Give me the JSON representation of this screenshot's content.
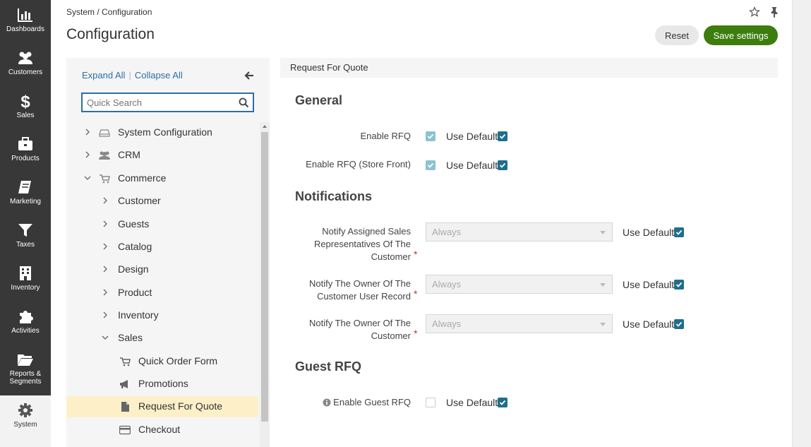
{
  "nav": {
    "items": [
      {
        "label": "Dashboards",
        "icon": "dashboards-icon"
      },
      {
        "label": "Customers",
        "icon": "customers-icon"
      },
      {
        "label": "Sales",
        "icon": "sales-icon"
      },
      {
        "label": "Products",
        "icon": "products-icon"
      },
      {
        "label": "Marketing",
        "icon": "marketing-icon"
      },
      {
        "label": "Taxes",
        "icon": "taxes-icon"
      },
      {
        "label": "Inventory",
        "icon": "inventory-icon"
      },
      {
        "label": "Activities",
        "icon": "activities-icon"
      },
      {
        "label": "Reports & Segments",
        "icon": "reports-icon"
      },
      {
        "label": "System",
        "icon": "gear-icon"
      }
    ]
  },
  "header": {
    "breadcrumb": "System / Configuration",
    "title": "Configuration",
    "reset_label": "Reset",
    "save_label": "Save settings"
  },
  "tree": {
    "expand_all": "Expand All",
    "collapse_all": "Collapse All",
    "search_placeholder": "Quick Search",
    "items": [
      {
        "label": "System Configuration"
      },
      {
        "label": "CRM"
      },
      {
        "label": "Commerce"
      },
      {
        "label": "Customer"
      },
      {
        "label": "Guests"
      },
      {
        "label": "Catalog"
      },
      {
        "label": "Design"
      },
      {
        "label": "Product"
      },
      {
        "label": "Inventory"
      },
      {
        "label": "Sales"
      },
      {
        "label": "Quick Order Form"
      },
      {
        "label": "Promotions"
      },
      {
        "label": "Request For Quote"
      },
      {
        "label": "Checkout"
      }
    ]
  },
  "content": {
    "section_title": "Request For Quote",
    "use_default": "Use Default",
    "general": {
      "heading": "General",
      "enable_rfq": "Enable RFQ",
      "enable_rfq_store": "Enable RFQ (Store Front)"
    },
    "notifications": {
      "heading": "Notifications",
      "notify_sales_reps": "Notify Assigned Sales Representatives Of The Customer",
      "notify_owner_user": "Notify The Owner Of The Customer User Record",
      "notify_owner_customer": "Notify The Owner Of The Customer",
      "select_value": "Always"
    },
    "guest": {
      "heading": "Guest RFQ",
      "enable_guest": "Enable Guest RFQ"
    }
  },
  "colors": {
    "accent": "#2d6ea8",
    "save": "#3c7d0e",
    "nav_bg": "#383838",
    "checkbox": "#1f6f8b"
  }
}
